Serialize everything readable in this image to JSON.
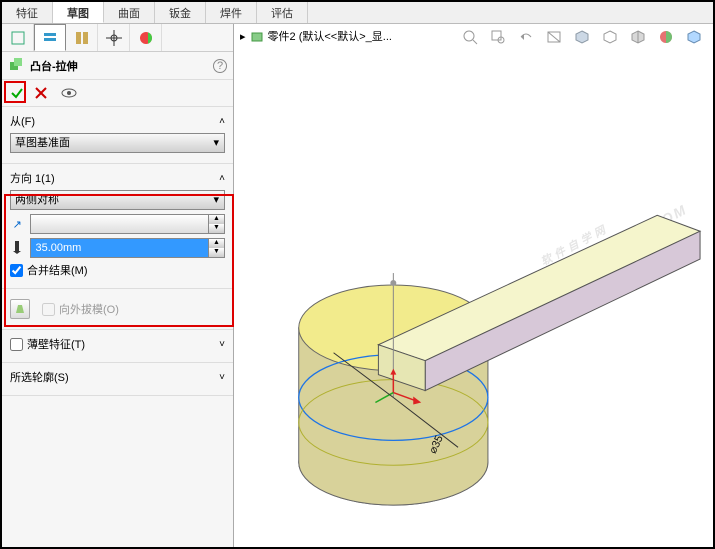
{
  "tabs": [
    "特征",
    "草图",
    "曲面",
    "钣金",
    "焊件",
    "评估"
  ],
  "active_tab": "草图",
  "breadcrumb": {
    "doc": "零件2 (默认<<默认>_显..."
  },
  "panel_icon_names": [
    "feature-tree-icon",
    "property-manager-icon",
    "configuration-icon",
    "dimxpert-icon",
    "appearance-icon"
  ],
  "feature": {
    "icon": "extrude-icon",
    "title": "凸台-拉伸"
  },
  "from": {
    "label": "从(F)",
    "value": "草图基准面"
  },
  "direction1": {
    "label": "方向 1(1)",
    "end_condition": "两侧对称",
    "depth_value": "",
    "distance": "35.00mm",
    "merge_label": "合并结果(M)",
    "merge_checked": true,
    "draft_label": "向外拔模(O)",
    "draft_checked": false
  },
  "thin": {
    "label": "薄壁特征(T)",
    "checked": false
  },
  "contours": {
    "label": "所选轮廓(S)"
  },
  "help_tooltip": "?",
  "dimension_label": "⌀35",
  "viewtool_names": [
    "zoom-fit-icon",
    "zoom-area-icon",
    "previous-view-icon",
    "section-view-icon",
    "view-orientation-icon",
    "display-style-icon",
    "hide-show-icon",
    "appearance-vp-icon",
    "settings-vp-icon"
  ],
  "watermark": {
    "line1": "软件自学网",
    "line2": "WWW.RJZXW.COM"
  }
}
